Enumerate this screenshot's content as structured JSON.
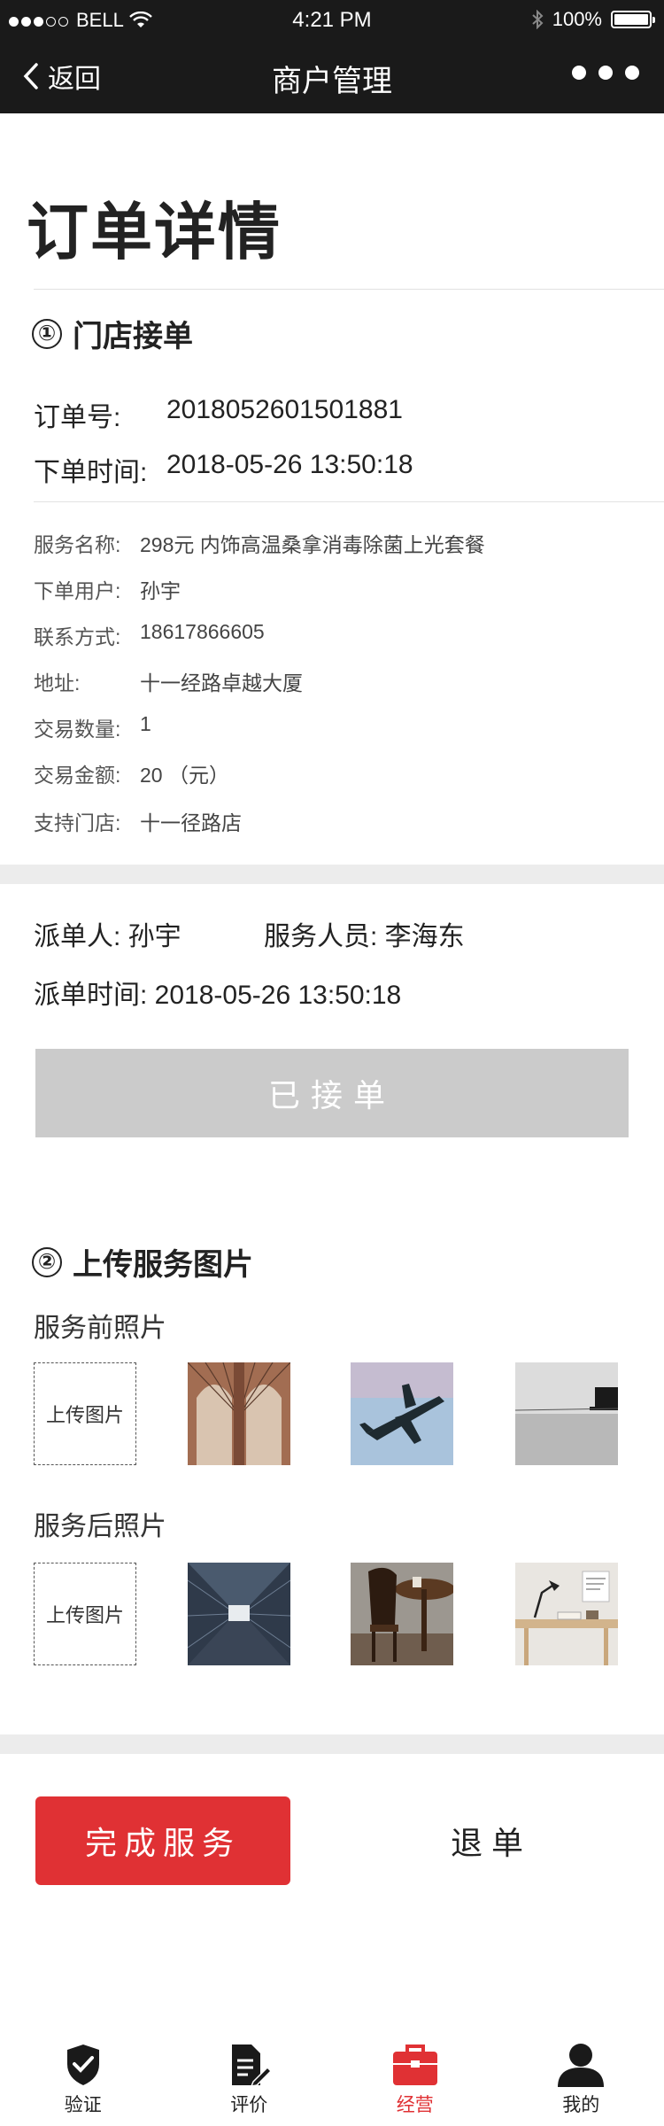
{
  "status_bar": {
    "carrier": "BELL",
    "time": "4:21 PM",
    "battery": "100%"
  },
  "nav": {
    "back_label": "返回",
    "title": "商户管理"
  },
  "page_title": "订单详情",
  "section1": {
    "number": "①",
    "title": "门店接单",
    "order_no_label": "订单号:",
    "order_no": "2018052601501881",
    "order_time_label": "下单时间:",
    "order_time": "2018-05-26 13:50:18",
    "details": [
      {
        "label": "服务名称:",
        "value": "298元 内饰高温桑拿消毒除菌上光套餐"
      },
      {
        "label": "下单用户:",
        "value": "孙宇"
      },
      {
        "label": "联系方式:",
        "value": "18617866605"
      },
      {
        "label": "地址:",
        "value": "十一经路卓越大厦"
      },
      {
        "label": "交易数量:",
        "value": "1"
      },
      {
        "label": "交易金额:",
        "value": "20 （元）"
      },
      {
        "label": "支持门店:",
        "value": "十一径路店"
      }
    ]
  },
  "dispatch": {
    "dispatcher": "派单人: 孙宇",
    "staff": "服务人员: 李海东",
    "time": "派单时间: 2018-05-26 13:50:18",
    "accepted_label": "已接单"
  },
  "section2": {
    "number": "②",
    "title": "上传服务图片",
    "before_label": "服务前照片",
    "after_label": "服务后照片",
    "upload_label": "上传图片"
  },
  "actions": {
    "finish_label": "完成服务",
    "refund_label": "退单"
  },
  "tabbar": [
    {
      "label": "验证",
      "icon": "shield-check-icon"
    },
    {
      "label": "评价",
      "icon": "document-edit-icon"
    },
    {
      "label": "经营",
      "icon": "briefcase-icon",
      "active": true
    },
    {
      "label": "我的",
      "icon": "user-icon"
    }
  ],
  "colors": {
    "accent": "#e03134",
    "topbar": "#1a1a1a",
    "disabled_button": "#cbcbcb"
  }
}
